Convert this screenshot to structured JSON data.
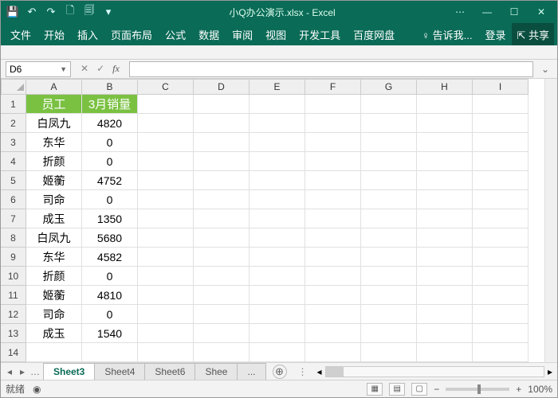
{
  "title": "小Q办公演示.xlsx - Excel",
  "qat": {
    "save": "💾",
    "undo": "↶",
    "redo": "↷",
    "new": "🗋",
    "print": "🗐",
    "more": "▾"
  },
  "win": {
    "opts": "⋯",
    "min": "—",
    "max": "☐",
    "close": "✕"
  },
  "tabs": [
    "文件",
    "开始",
    "插入",
    "页面布局",
    "公式",
    "数据",
    "审阅",
    "视图",
    "开发工具",
    "百度网盘"
  ],
  "tell": "♀ 告诉我...",
  "login": "登录",
  "share": "⇱ 共享",
  "namebox": "D6",
  "fx": "fx",
  "cols": [
    "A",
    "B",
    "C",
    "D",
    "E",
    "F",
    "G",
    "H",
    "I"
  ],
  "header": [
    "员工",
    "3月销量"
  ],
  "data": [
    [
      "白凤九",
      "4820"
    ],
    [
      "东华",
      "0"
    ],
    [
      "折颜",
      "0"
    ],
    [
      "姬蘅",
      "4752"
    ],
    [
      "司命",
      "0"
    ],
    [
      "成玉",
      "1350"
    ],
    [
      "白凤九",
      "5680"
    ],
    [
      "东华",
      "4582"
    ],
    [
      "折颜",
      "0"
    ],
    [
      "姬蘅",
      "4810"
    ],
    [
      "司命",
      "0"
    ],
    [
      "成玉",
      "1540"
    ]
  ],
  "sheetTabs": [
    "Sheet3",
    "Sheet4",
    "Sheet6",
    "Shee",
    "..."
  ],
  "activeSheet": 0,
  "status": {
    "ready": "就绪",
    "rec": "◉",
    "views": [
      "▦",
      "▤",
      "▢"
    ],
    "minus": "−",
    "plus": "+",
    "zoom": "100%"
  },
  "hsbArrows": {
    "l": "◂",
    "r": "▸"
  },
  "tabnav": [
    "◂",
    "▸",
    "…"
  ]
}
